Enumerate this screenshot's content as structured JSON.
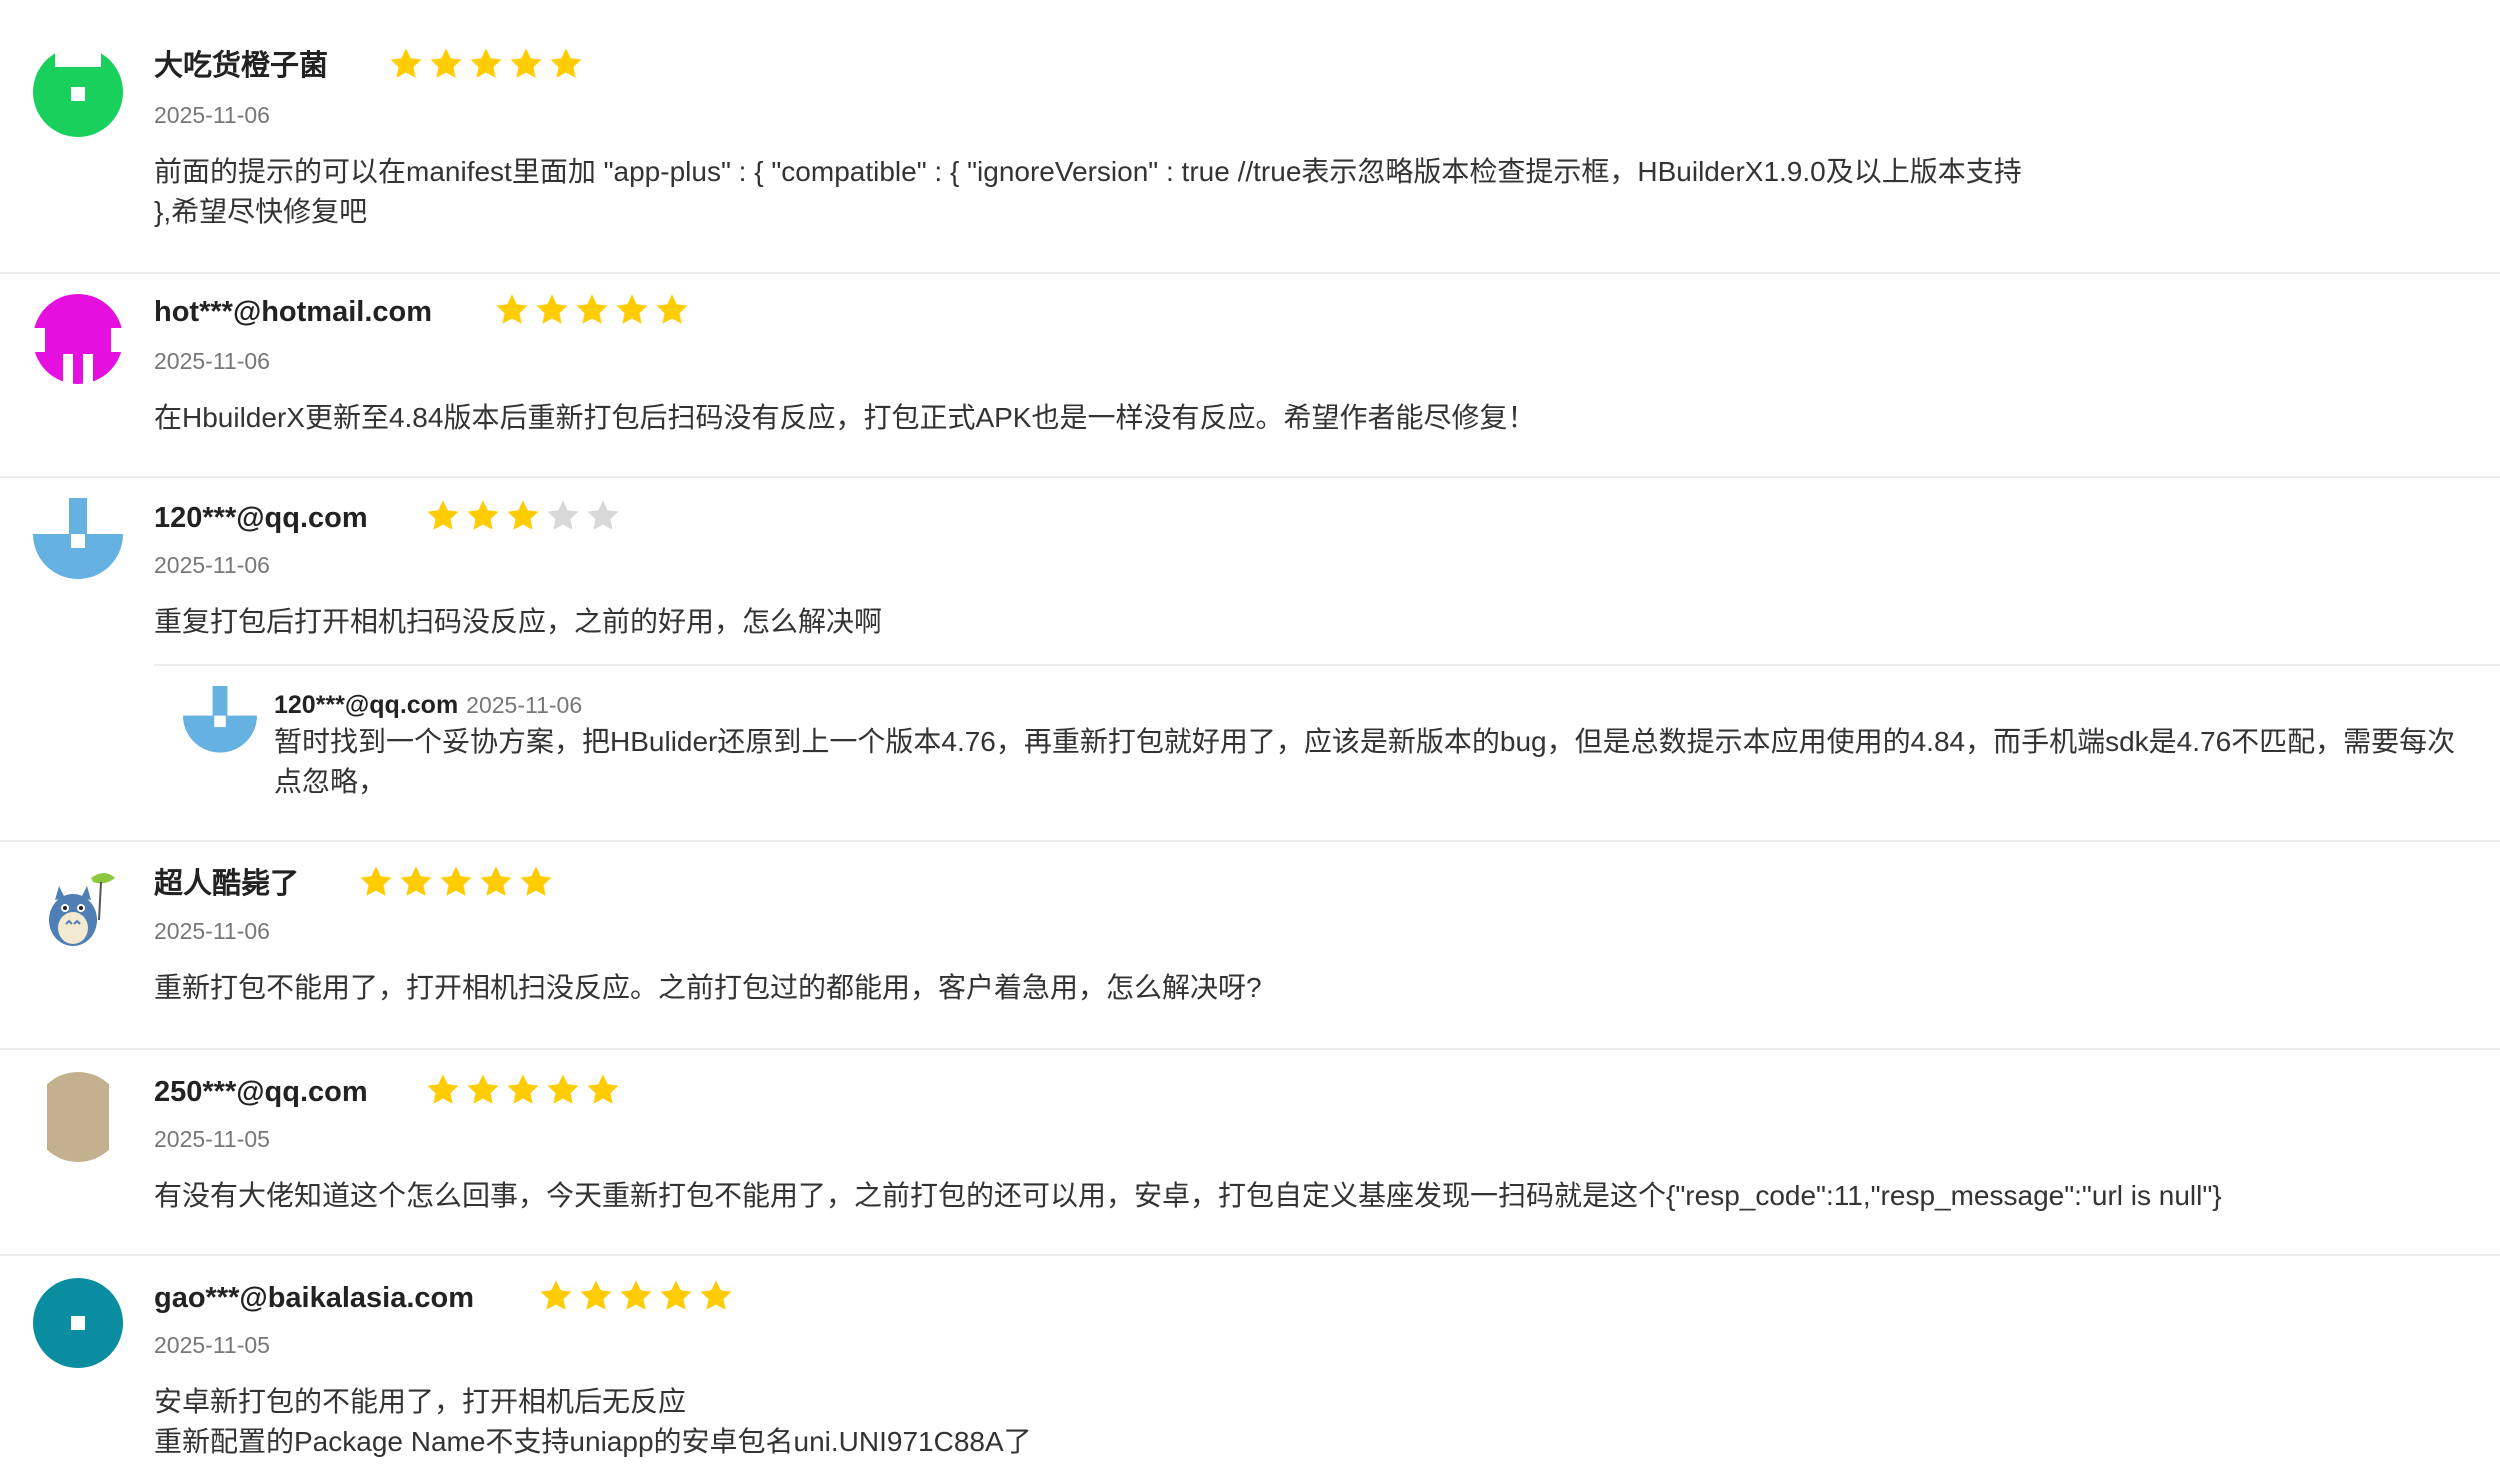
{
  "colors": {
    "star_on": "#ffcc00",
    "star_off": "#d8d8d8"
  },
  "reviews": [
    {
      "name": "大吃货橙子菌",
      "rating": 5,
      "date": "2025-11-06",
      "text": "前面的提示的可以在manifest里面加 \"app-plus\" : { \"compatible\" : { \"ignoreVersion\" : true //true表示忽略版本检查提示框，HBuilderX1.9.0及以上版本支持\n},希望尽快修复吧",
      "avatar": {
        "icon": "identicon-avatar",
        "color": "#19d05c"
      }
    },
    {
      "name": "hot***@hotmail.com",
      "rating": 5,
      "date": "2025-11-06",
      "text": "在HbuilderX更新至4.84版本后重新打包后扫码没有反应，打包正式APK也是一样没有反应。希望作者能尽修复！",
      "avatar": {
        "icon": "identicon-avatar",
        "color": "#e510e0"
      }
    },
    {
      "name": "120***@qq.com",
      "rating": 3,
      "date": "2025-11-06",
      "text": "重复打包后打开相机扫码没反应，之前的好用，怎么解决啊",
      "avatar": {
        "icon": "identicon-avatar",
        "color": "#64b1e2"
      },
      "reply": {
        "name": "120***@qq.com",
        "date": "2025-11-06",
        "text": "暂时找到一个妥协方案，把HBulider还原到上一个版本4.76，再重新打包就好用了，应该是新版本的bug，但是总数提示本应用使用的4.84，而手机端sdk是4.76不匹配，需要每次点忽略，",
        "avatar": {
          "icon": "identicon-avatar",
          "color": "#64b1e2"
        }
      }
    },
    {
      "name": "超人酷毙了",
      "rating": 5,
      "date": "2025-11-06",
      "text": "重新打包不能用了，打开相机扫没反应。之前打包过的都能用，客户着急用，怎么解决呀?",
      "avatar": {
        "icon": "totoro-avatar",
        "color": "#4f7fb5"
      }
    },
    {
      "name": "250***@qq.com",
      "rating": 5,
      "date": "2025-11-05",
      "text": "有没有大佬知道这个怎么回事，今天重新打包不能用了，之前打包的还可以用，安卓，打包自定义基座发现一扫码就是这个{\"resp_code\":11,\"resp_message\":\"url is null\"}",
      "avatar": {
        "icon": "identicon-avatar",
        "color": "#c2b08f"
      }
    },
    {
      "name": "gao***@baikalasia.com",
      "rating": 5,
      "date": "2025-11-05",
      "text": "安卓新打包的不能用了，打开相机后无反应\n重新配置的Package Name不支持uniapp的安卓包名uni.UNI971C88A了",
      "avatar": {
        "icon": "identicon-avatar",
        "color": "#0a8da0"
      }
    }
  ]
}
